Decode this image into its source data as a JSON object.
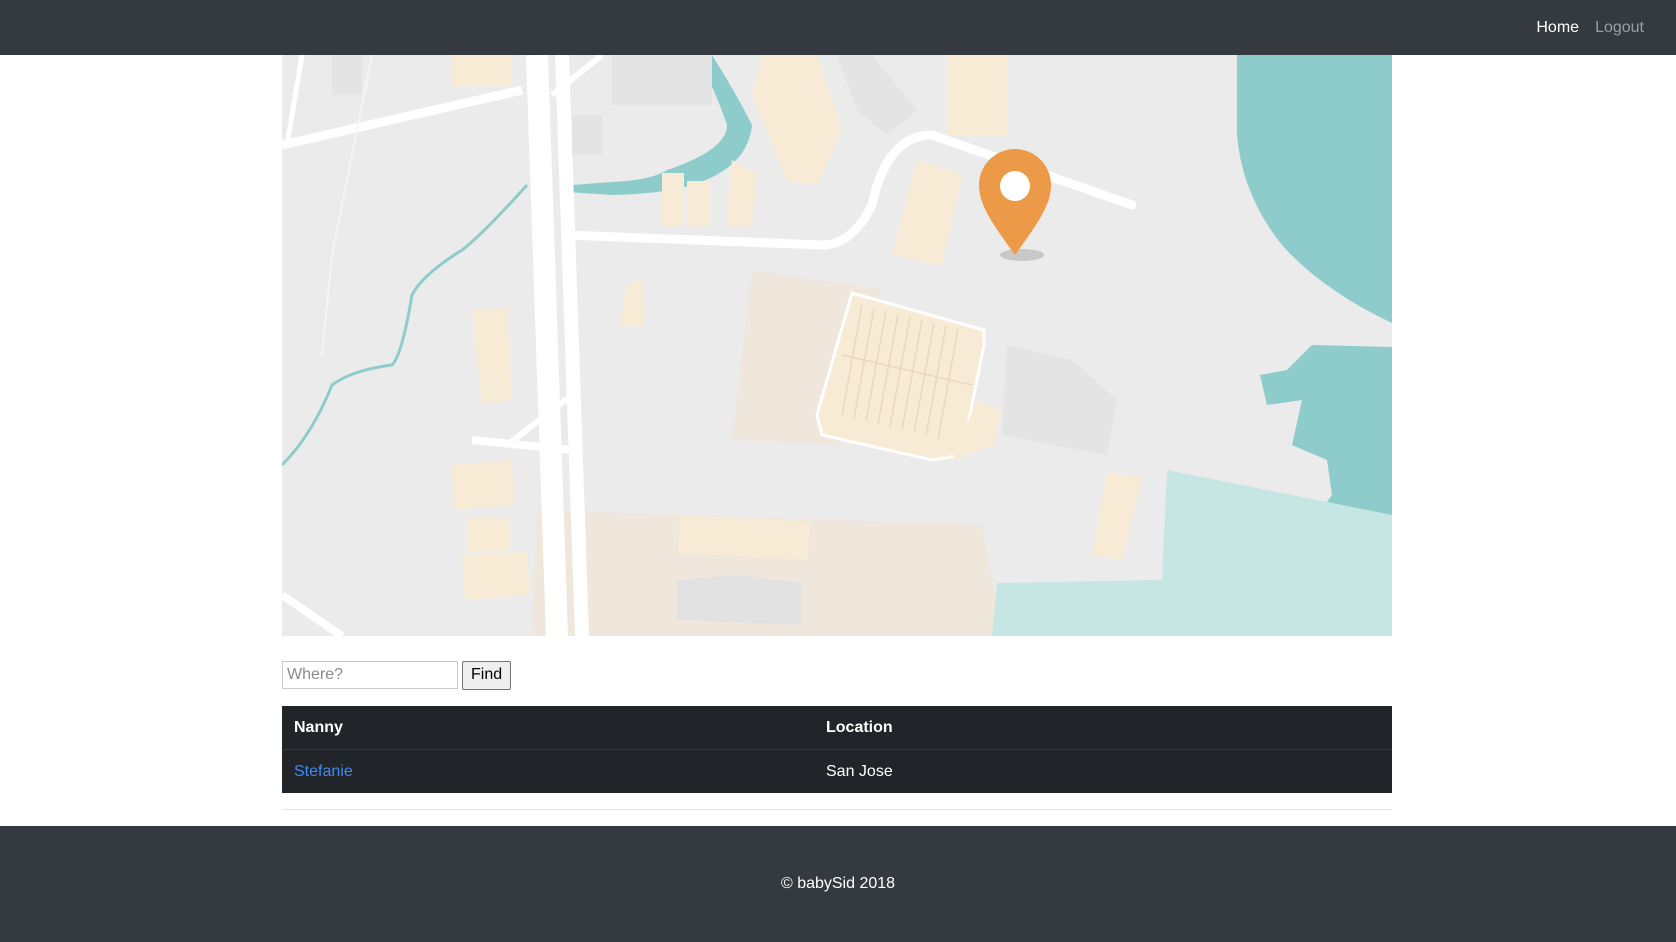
{
  "nav": {
    "links": [
      {
        "label": "Home",
        "active": true
      },
      {
        "label": "Logout",
        "active": false
      }
    ]
  },
  "map": {
    "marker_icon": "map-pin-icon",
    "marker_color": "#ec9a48",
    "water_color": "#8ecccb",
    "building_color": "#f7ebd5",
    "road_color": "#ffffff",
    "land_color": "#ebebeb"
  },
  "search": {
    "placeholder": "Where?",
    "value": "",
    "button_label": "Find"
  },
  "table": {
    "headers": [
      "Nanny",
      "Location"
    ],
    "rows": [
      {
        "nanny": "Stefanie",
        "location": "San Jose"
      }
    ]
  },
  "footer": {
    "text": "© babySid 2018"
  }
}
